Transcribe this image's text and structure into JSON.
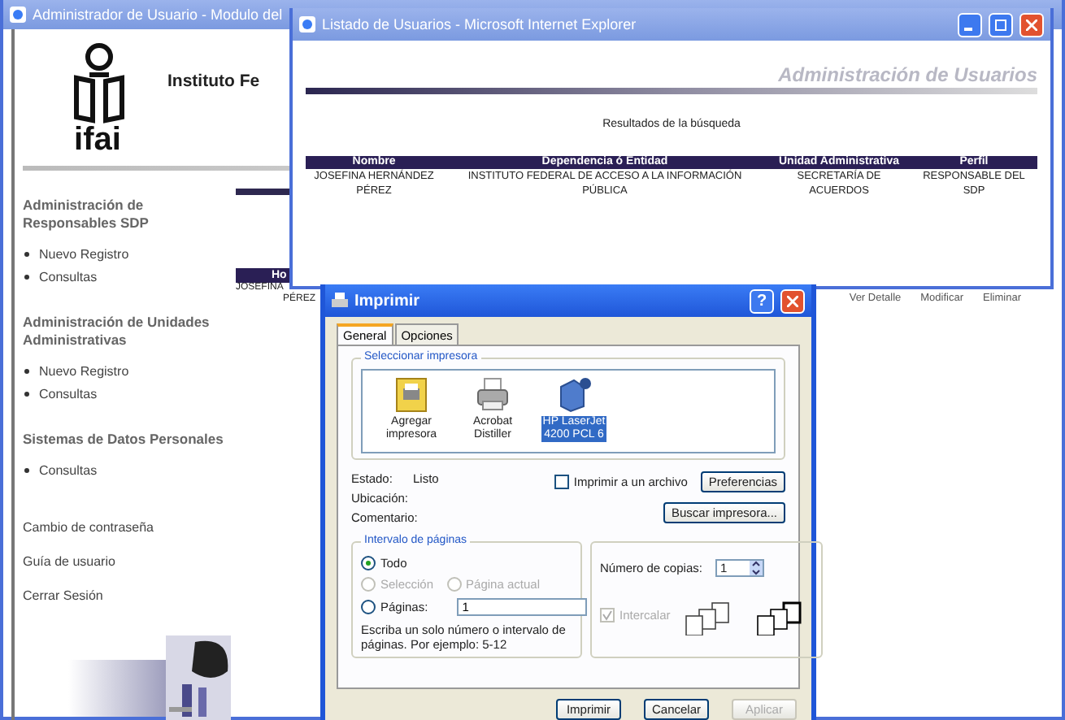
{
  "back_window": {
    "title": "Administrador de Usuario - Modulo del",
    "logo_text": "ifai",
    "heading": "Instituto Fe",
    "sections": [
      {
        "title": "Administración de Responsables SDP",
        "items": [
          "Nuevo Registro",
          "Consultas"
        ]
      },
      {
        "title": "Administración de Unidades Administrativas",
        "items": [
          "Nuevo Registro",
          "Consultas"
        ]
      },
      {
        "title": "Sistemas de Datos Personales",
        "items": [
          "Consultas"
        ]
      }
    ],
    "links": [
      "Cambio de contraseña",
      "Guía de usuario",
      "Cerrar Sesión"
    ],
    "table_header": "Ho",
    "table_row": [
      "JOSEFINA",
      "PÉREZ"
    ],
    "row_actions": [
      "Ver Detalle",
      "Modificar",
      "Eliminar"
    ]
  },
  "results_window": {
    "title": "Listado de Usuarios - Microsoft Internet Explorer",
    "banner": "Administración de Usuarios",
    "caption": "Resultados de la búsqueda",
    "columns": [
      "Nombre",
      "Dependencia ó Entidad",
      "Unidad Administrativa",
      "Perfil"
    ],
    "rows": [
      [
        "JOSEFINA HERNÁNDEZ PÉREZ",
        "INSTITUTO FEDERAL DE ACCESO A LA INFORMACIÓN PÚBLICA",
        "SECRETARÍA DE ACUERDOS",
        "RESPONSABLE DEL SDP"
      ]
    ]
  },
  "print_dialog": {
    "title": "Imprimir",
    "help": "?",
    "tabs": [
      {
        "label": "General",
        "selected": true
      },
      {
        "label": "Opciones",
        "selected": false
      }
    ],
    "printer_group": "Seleccionar impresora",
    "printers": [
      {
        "kind": "add",
        "label": "Agregar impresora",
        "selected": false
      },
      {
        "kind": "printer",
        "label": "Acrobat Distiller",
        "selected": false
      },
      {
        "kind": "network",
        "label": "HP LaserJet 4200 PCL 6",
        "selected": true
      }
    ],
    "info": [
      {
        "label": "Estado:",
        "value": "Listo"
      },
      {
        "label": "Ubicación:"
      },
      {
        "label": "Comentario:"
      }
    ],
    "print_to_file": {
      "label": "Imprimir a un archivo",
      "checked": false
    },
    "preferences": "Preferencias",
    "find_printer": "Buscar impresora...",
    "range_group": "Intervalo de páginas",
    "range_options": [
      {
        "label": "Todo",
        "selected": true,
        "disabled": false
      },
      {
        "label": "Selección",
        "selected": false,
        "disabled": true
      },
      {
        "label": "Página actual",
        "selected": false,
        "disabled": true
      },
      {
        "label": "Páginas:",
        "selected": false,
        "disabled": false
      }
    ],
    "pages_value": "1",
    "range_hint": "Escriba un solo número o intervalo de páginas. Por ejemplo: 5-12",
    "copies_label": "Número de copias:",
    "copies_value": "1",
    "collate": {
      "label": "Intercalar",
      "checked": true,
      "disabled": true
    },
    "buttons": [
      {
        "label": "Imprimir",
        "disabled": false
      },
      {
        "label": "Cancelar",
        "disabled": false
      },
      {
        "label": "Aplicar",
        "disabled": true
      }
    ]
  }
}
